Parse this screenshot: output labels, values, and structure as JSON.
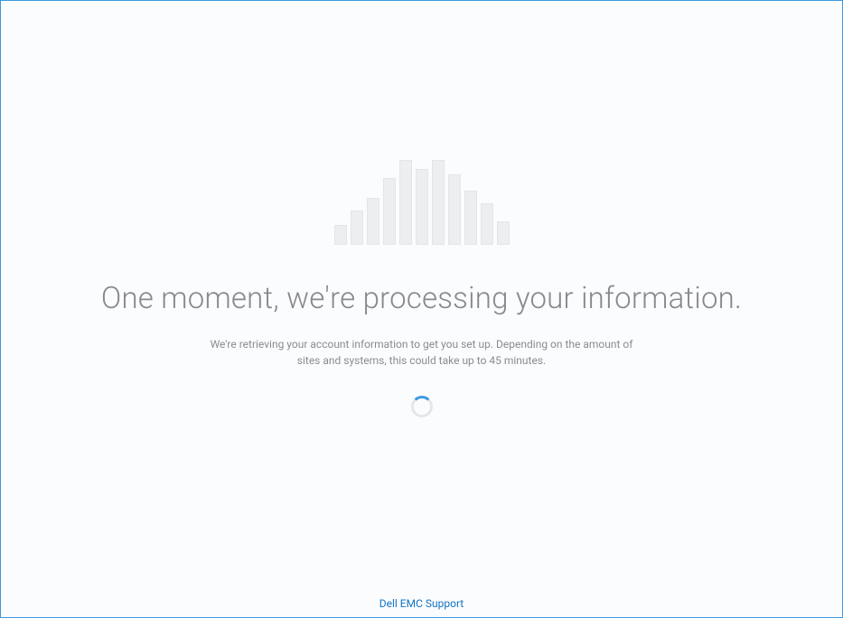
{
  "heading": "One moment, we're processing your information.",
  "subtext": "We're retrieving your account information to get you set up. Depending on the amount of sites and systems, this could take up to 45 minutes.",
  "footer_link": "Dell EMC Support"
}
